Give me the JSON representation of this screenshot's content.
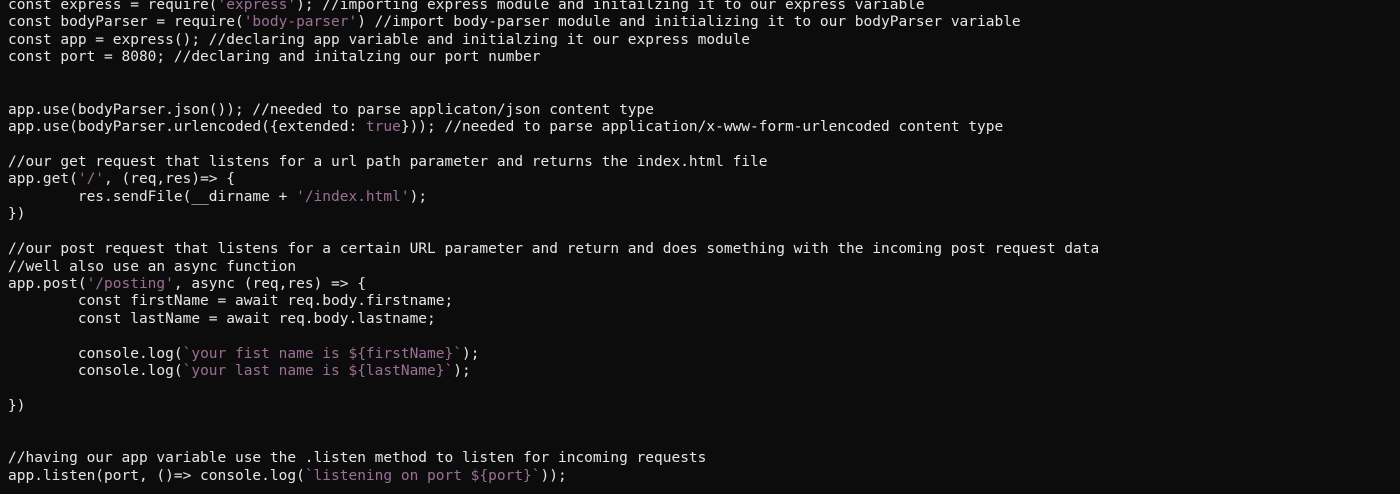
{
  "editor": {
    "lines": [
      [
        {
          "t": "const express = require("
        },
        {
          "t": "'express'",
          "k": "str"
        },
        {
          "t": "); //importing express module and initailzing it to our express variable"
        }
      ],
      [
        {
          "t": "const bodyParser = require("
        },
        {
          "t": "'body-parser'",
          "k": "str"
        },
        {
          "t": ") //import body-parser module and initializing it to our bodyParser variable"
        }
      ],
      [
        {
          "t": "const app = express(); //declaring app variable and initialzing it our express module"
        }
      ],
      [
        {
          "t": "const port = 8080; //declaring and initalzing our port number"
        }
      ],
      [],
      [],
      [
        {
          "t": "app.use(bodyParser.json()); //needed to parse applicaton/json content type"
        }
      ],
      [
        {
          "t": "app.use(bodyParser.urlencoded({extended: "
        },
        {
          "t": "true",
          "k": "bool"
        },
        {
          "t": "})); //needed to parse application/x-www-form-urlencoded content type"
        }
      ],
      [],
      [
        {
          "t": "//our get request that listens for a url path parameter and returns the index.html file"
        }
      ],
      [
        {
          "t": "app.get("
        },
        {
          "t": "'/'",
          "k": "str"
        },
        {
          "t": ", (req,res)=> {"
        }
      ],
      [
        {
          "t": "        res.sendFile(__dirname + "
        },
        {
          "t": "'/index.html'",
          "k": "str"
        },
        {
          "t": ");"
        }
      ],
      [
        {
          "t": "})"
        }
      ],
      [],
      [
        {
          "t": "//our post request that listens for a certain URL parameter and return and does something with the incoming post request data"
        }
      ],
      [
        {
          "t": "//well also use an async function"
        }
      ],
      [
        {
          "t": "app.post("
        },
        {
          "t": "'/posting'",
          "k": "str"
        },
        {
          "t": ", async (req,res) => {"
        }
      ],
      [
        {
          "t": "        const firstName = await req.body.firstname;"
        }
      ],
      [
        {
          "t": "        const lastName = await req.body.lastname;"
        }
      ],
      [],
      [
        {
          "t": "        console.log("
        },
        {
          "t": "`your fist name is ${firstName}`",
          "k": "str"
        },
        {
          "t": ");"
        }
      ],
      [
        {
          "t": "        console.log("
        },
        {
          "t": "`your last name is ${lastName}`",
          "k": "str"
        },
        {
          "t": ");"
        }
      ],
      [],
      [
        {
          "t": "})"
        }
      ],
      [],
      [],
      [
        {
          "t": "//having our app variable use the .listen method to listen for incoming requests"
        }
      ],
      [
        {
          "t": "app.listen(port, ()=> console.log("
        },
        {
          "t": "`listening on port ${port}`",
          "k": "str"
        },
        {
          "t": "));"
        }
      ]
    ]
  },
  "colors": {
    "background": "#0c0c0c",
    "text": "#e6e6e6",
    "string": "#9d6f97"
  }
}
